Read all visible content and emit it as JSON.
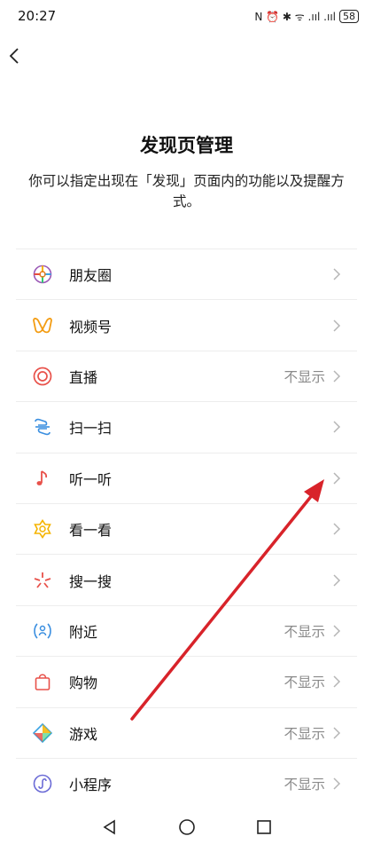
{
  "status_bar": {
    "time": "20:27",
    "signal_text": "N ⏰ ✱ ᯤ .ııl .ııl",
    "battery": "58"
  },
  "page": {
    "title": "发现页管理",
    "description": "你可以指定出现在「发现」页面内的功能以及提醒方式。"
  },
  "items": [
    {
      "label": "朋友圈",
      "value": "",
      "icon": "moments-icon"
    },
    {
      "label": "视频号",
      "value": "",
      "icon": "channels-icon"
    },
    {
      "label": "直播",
      "value": "不显示",
      "icon": "live-icon"
    },
    {
      "label": "扫一扫",
      "value": "",
      "icon": "scan-icon"
    },
    {
      "label": "听一听",
      "value": "",
      "icon": "listen-icon"
    },
    {
      "label": "看一看",
      "value": "",
      "icon": "top-stories-icon"
    },
    {
      "label": "搜一搜",
      "value": "",
      "icon": "search-icon"
    },
    {
      "label": "附近",
      "value": "不显示",
      "icon": "nearby-icon"
    },
    {
      "label": "购物",
      "value": "不显示",
      "icon": "shopping-icon"
    },
    {
      "label": "游戏",
      "value": "不显示",
      "icon": "games-icon"
    },
    {
      "label": "小程序",
      "value": "不显示",
      "icon": "mini-programs-icon"
    }
  ],
  "colors": {
    "annotation_arrow": "#d8232a",
    "chevron": "#b5b5b5"
  }
}
